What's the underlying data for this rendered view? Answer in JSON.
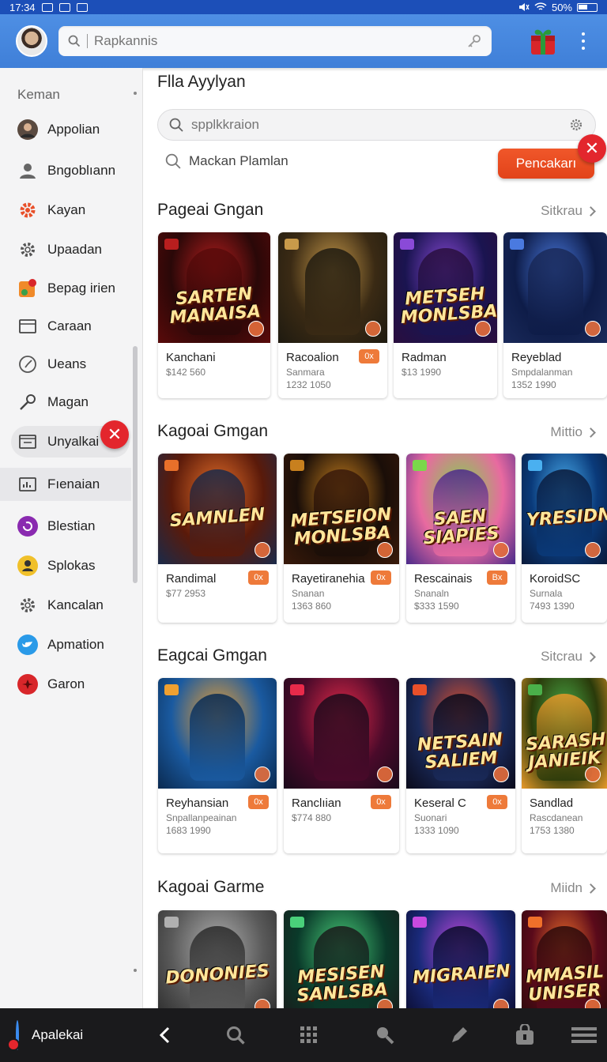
{
  "status_bar": {
    "time": "17:34",
    "battery": "50%"
  },
  "app_bar": {
    "search_placeholder": "Rapkannis"
  },
  "sidebar": {
    "heading": "Keman",
    "items": [
      {
        "label": "Appolian",
        "icon": "avatar-icon"
      },
      {
        "label": "Bngoblıann",
        "icon": "person-icon"
      },
      {
        "label": "Kayan",
        "icon": "gear-icon"
      },
      {
        "label": "Upaadan",
        "icon": "gear-icon"
      },
      {
        "label": "Bepag irien",
        "icon": "app-badge-icon"
      },
      {
        "label": "Caraan",
        "icon": "window-icon"
      },
      {
        "label": "Ueans",
        "icon": "clock-icon"
      },
      {
        "label": "Magan",
        "icon": "key-icon"
      },
      {
        "label": "Unyalkai",
        "icon": "inbox-icon"
      },
      {
        "label": "Fıenaian",
        "icon": "chart-icon"
      },
      {
        "label": "Blestian",
        "icon": "circle-arrow-icon"
      },
      {
        "label": "Splokas",
        "icon": "person-badge-icon"
      },
      {
        "label": "Kancalan",
        "icon": "gear-icon"
      },
      {
        "label": "Apmation",
        "icon": "bird-icon"
      },
      {
        "label": "Garon",
        "icon": "record-icon"
      }
    ]
  },
  "main": {
    "title": "Flla Ayylyan",
    "filter_placeholder": "spplkkraion",
    "secondary_search": "Mackan Plamlan",
    "primary_button": "Pencakarı",
    "sections": [
      {
        "title": "Pageai Gngan",
        "link": "Sitkrau",
        "cards": [
          {
            "name": "Kanchani",
            "sub": "$142 560",
            "meta": "",
            "pill": "",
            "logo": "SARTEN MANAISA",
            "palette": [
              "#2a0808",
              "#b81e1e",
              "#5a0a0a"
            ]
          },
          {
            "name": "Racoalion",
            "sub": "Sanmara",
            "meta": "1232 1050",
            "pill": "0x",
            "logo": "",
            "palette": [
              "#3a2a14",
              "#c89a4a",
              "#1e1a10"
            ]
          },
          {
            "name": "Radman",
            "sub": "$13 1990",
            "meta": "",
            "pill": "",
            "logo": "METSEH MONLSBA",
            "palette": [
              "#1a1450",
              "#8a4ad8",
              "#2a0e3e"
            ]
          },
          {
            "name": "Reyeblad",
            "sub": "Smpdalanman",
            "meta": "1352 1990",
            "pill": "",
            "logo": "",
            "palette": [
              "#0e1c48",
              "#4a7ae0",
              "#1a2a5a"
            ]
          }
        ]
      },
      {
        "title": "Kagoai Gmgan",
        "link": "Mittio",
        "cards": [
          {
            "name": "Randimal",
            "sub": "$77 2953",
            "meta": "",
            "pill": "0x",
            "logo": "SAMNLEN",
            "palette": [
              "#5a1a0a",
              "#e8702a",
              "#1a2a4a"
            ]
          },
          {
            "name": "Rayetiranehia",
            "sub": "Snanan",
            "meta": "1363 860",
            "pill": "0x",
            "logo": "METSEION MONLSBA",
            "palette": [
              "#1a0e08",
              "#c8801e",
              "#3a1a0a"
            ]
          },
          {
            "name": "Rescainais",
            "sub": "Snanaln",
            "meta": "$333 1590",
            "pill": "Bx",
            "logo": "SAEN SIAPIES",
            "palette": [
              "#e86aa0",
              "#7ad84a",
              "#4a2a8a"
            ]
          },
          {
            "name": "KoroidSC",
            "sub": "Surnala",
            "meta": "7493 1390",
            "pill": "",
            "logo": "YRESIDN",
            "palette": [
              "#0a3a7a",
              "#4ab0f0",
              "#0a1a3a"
            ]
          }
        ]
      },
      {
        "title": "Eagcai Gmgan",
        "link": "Sitcrau",
        "cards": [
          {
            "name": "Reyhansian",
            "sub": "Snpallanpeainan",
            "meta": "1683 1990",
            "pill": "0x",
            "logo": "",
            "palette": [
              "#1a5aa0",
              "#f0a030",
              "#0a2a50"
            ]
          },
          {
            "name": "Ranclıian",
            "sub": "$774 880",
            "meta": "",
            "pill": "0x",
            "logo": "",
            "palette": [
              "#4a0a2a",
              "#e82a4a",
              "#1a0a1a"
            ]
          },
          {
            "name": "Keseral C",
            "sub": "Suonari",
            "meta": "1333 1090",
            "pill": "0x",
            "logo": "NETSAIN SALIEM",
            "palette": [
              "#1a2a5a",
              "#e8502a",
              "#0a0a1a"
            ]
          },
          {
            "name": "Sandlad",
            "sub": "Rascdanean",
            "meta": "1753 1380",
            "pill": "",
            "logo": "SARASH JANIEIK",
            "palette": [
              "#2a3a0a",
              "#4ab04a",
              "#e89a2a"
            ]
          }
        ]
      },
      {
        "title": "Kagoai Garme",
        "link": "Miidn",
        "cards": [
          {
            "name": "",
            "sub": "",
            "meta": "",
            "pill": "",
            "logo": "DONONIES",
            "palette": [
              "#5a5a5a",
              "#b0b0b0",
              "#2a2a2a"
            ]
          },
          {
            "name": "",
            "sub": "",
            "meta": "",
            "pill": "",
            "logo": "MESISEN SANLSBA",
            "palette": [
              "#0a3a2a",
              "#4ad07a",
              "#1a1a1a"
            ]
          },
          {
            "name": "",
            "sub": "",
            "meta": "",
            "pill": "",
            "logo": "MIGRAIEN",
            "palette": [
              "#1a2a7a",
              "#c84ae0",
              "#0a0a2a"
            ]
          },
          {
            "name": "",
            "sub": "",
            "meta": "",
            "pill": "",
            "logo": "MMASIL UNISER",
            "palette": [
              "#5a0a1a",
              "#f0702a",
              "#2a0a0a"
            ]
          }
        ]
      }
    ]
  },
  "bottom_nav": {
    "label": "Apalekai",
    "icons": [
      "back-icon",
      "search-icon",
      "grid-icon",
      "search-alt-icon",
      "pen-icon",
      "bag-icon",
      "menu-icon"
    ]
  }
}
